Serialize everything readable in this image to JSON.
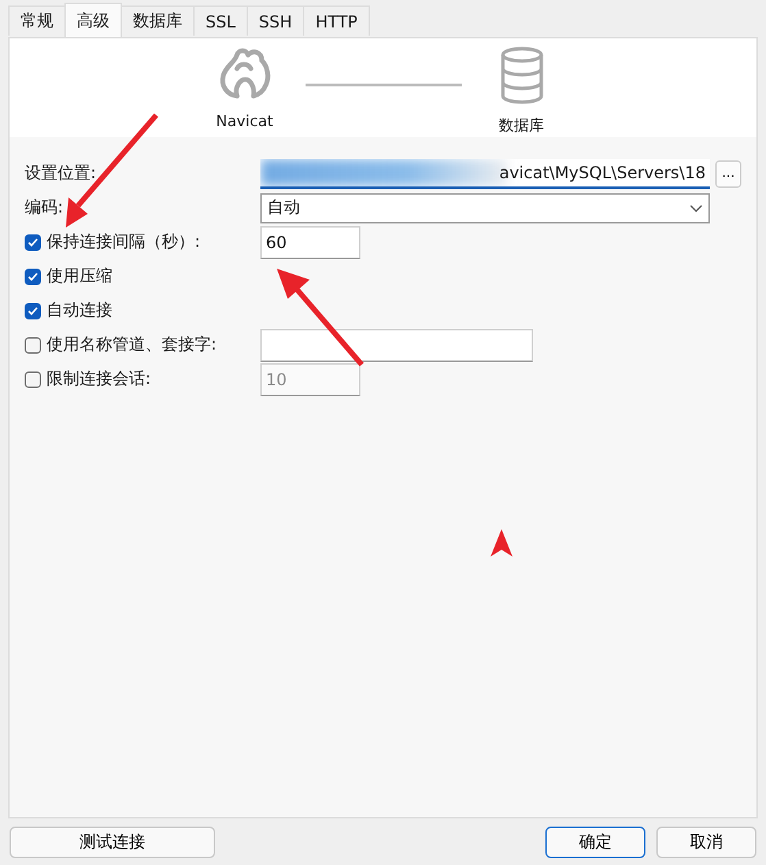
{
  "tabs": [
    {
      "label": "常规",
      "selected": false
    },
    {
      "label": "高级",
      "selected": true
    },
    {
      "label": "数据库",
      "selected": false
    },
    {
      "label": "SSL",
      "selected": false
    },
    {
      "label": "SSH",
      "selected": false
    },
    {
      "label": "HTTP",
      "selected": false
    }
  ],
  "diagram": {
    "source": "Navicat",
    "target": "数据库"
  },
  "location": {
    "label": "设置位置:",
    "value": "avicat\\MySQL\\Servers\\18",
    "browse": "..."
  },
  "encoding": {
    "label": "编码:",
    "value": "自动"
  },
  "options": [
    {
      "label": "保持连接间隔（秒）:",
      "checked": true,
      "field": "60",
      "field_disabled": false,
      "field_wide": false
    },
    {
      "label": "使用压缩",
      "checked": true
    },
    {
      "label": "自动连接",
      "checked": true
    },
    {
      "label": "使用名称管道、套接字:",
      "checked": false,
      "field_disabled": false,
      "field_wide": true
    },
    {
      "label": "限制连接会话:",
      "checked": false,
      "field": "10",
      "field_disabled": true,
      "field_wide": false
    }
  ],
  "buttons": [
    {
      "label": "测试连接",
      "kind": "left"
    },
    {
      "label": "确定",
      "kind": "default"
    },
    {
      "label": "取消",
      "kind": "normal"
    }
  ]
}
